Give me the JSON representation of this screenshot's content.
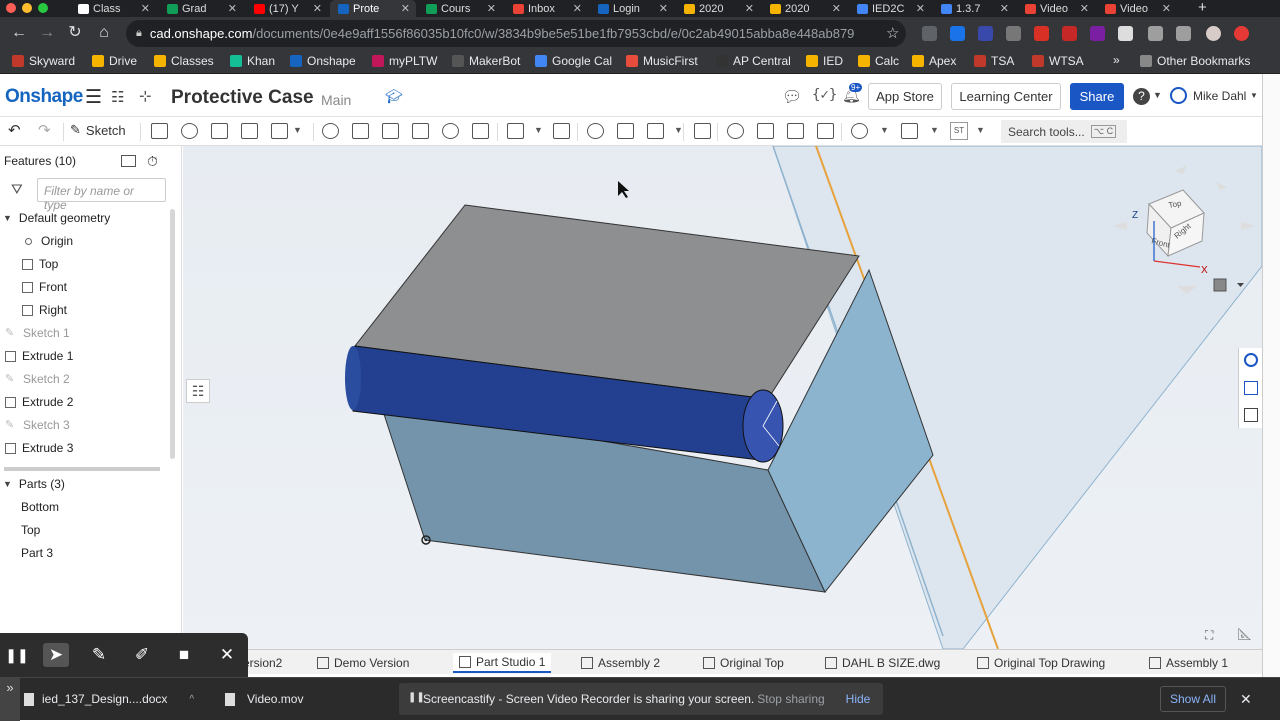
{
  "browser": {
    "tabs": [
      {
        "label": "Class",
        "color": "#ffffff"
      },
      {
        "label": "Grad",
        "color": "#0f9d58"
      },
      {
        "label": "(17) Y",
        "color": "#ff0000"
      },
      {
        "label": "Prote",
        "color": "#1565c0"
      },
      {
        "label": "Cours",
        "color": "#0f9d58"
      },
      {
        "label": "Inbox",
        "color": "#ea4335"
      },
      {
        "label": "Login",
        "color": "#1565c0"
      },
      {
        "label": "2020",
        "color": "#f4b400"
      },
      {
        "label": "2020",
        "color": "#f4b400"
      },
      {
        "label": "IED2C",
        "color": "#4285f4"
      },
      {
        "label": "1.3.7",
        "color": "#4285f4"
      },
      {
        "label": "Video",
        "color": "#ea4335"
      },
      {
        "label": "Video",
        "color": "#ea4335"
      }
    ],
    "url_host": "cad.onshape.com",
    "url_path": "/documents/0e4e9aff1556f86035b10fc0/w/3834b9be5e51be1fb7953cbd/e/0c2ab49015abba8e448ab879",
    "bookmarks": [
      {
        "label": "Skyward",
        "color": "#c0392b"
      },
      {
        "label": "Drive",
        "color": "#f4b400"
      },
      {
        "label": "Classes",
        "color": "#f4b400"
      },
      {
        "label": "Khan",
        "color": "#14bf96"
      },
      {
        "label": "Onshape",
        "color": "#1565c0"
      },
      {
        "label": "myPLTW",
        "color": "#c2185b"
      },
      {
        "label": "MakerBot",
        "color": "#555555"
      },
      {
        "label": "Google Cal",
        "color": "#4285f4"
      },
      {
        "label": "MusicFirst",
        "color": "#e74c3c"
      },
      {
        "label": "AP Central",
        "color": "#333333"
      },
      {
        "label": "IED",
        "color": "#f4b400"
      },
      {
        "label": "Calc",
        "color": "#f4b400"
      },
      {
        "label": "Apex",
        "color": "#f4b400"
      },
      {
        "label": "TSA",
        "color": "#c0392b"
      },
      {
        "label": "WTSA",
        "color": "#c0392b"
      }
    ],
    "bookmarks_more": "»",
    "other_bookmarks": "Other Bookmarks"
  },
  "header": {
    "logo": "Onshape",
    "doc_title": "Protective Case",
    "branch": "Main",
    "notif_count": "9+",
    "app_store": "App Store",
    "learning_center": "Learning Center",
    "share": "Share",
    "user": "Mike Dahl",
    "help": "?"
  },
  "toolbar": {
    "sketch_label": "Sketch",
    "search_label": "Search tools...",
    "search_shortcut": "⌥ C",
    "st_label": "ST"
  },
  "features": {
    "title": "Features (10)",
    "filter_placeholder": "Filter by name or type",
    "default_geometry": "Default geometry",
    "items": [
      {
        "label": "Origin",
        "greyed": false
      },
      {
        "label": "Top",
        "greyed": false
      },
      {
        "label": "Front",
        "greyed": false
      },
      {
        "label": "Right",
        "greyed": false
      },
      {
        "label": "Sketch 1",
        "greyed": true
      },
      {
        "label": "Extrude 1",
        "greyed": false
      },
      {
        "label": "Sketch 2",
        "greyed": true
      },
      {
        "label": "Extrude 2",
        "greyed": false
      },
      {
        "label": "Sketch 3",
        "greyed": true
      },
      {
        "label": "Extrude 3",
        "greyed": false
      }
    ],
    "parts_title": "Parts (3)",
    "parts": [
      "Bottom",
      "Top",
      "Part 3"
    ]
  },
  "viewcube": {
    "top": "Top",
    "front": "Front",
    "right": "Right",
    "axis_z": "Z",
    "axis_x": "X"
  },
  "bottom_tabs": [
    {
      "label": "ersion2",
      "active": false
    },
    {
      "label": "Demo Version",
      "active": false
    },
    {
      "label": "Part Studio 1",
      "active": true
    },
    {
      "label": "Assembly 2",
      "active": false
    },
    {
      "label": "Original Top",
      "active": false
    },
    {
      "label": "DAHL B SIZE.dwg",
      "active": false
    },
    {
      "label": "Original Top Drawing",
      "active": false
    },
    {
      "label": "Assembly 1",
      "active": false
    }
  ],
  "downloads": {
    "file1": "ied_137_Design....docx",
    "file2": "Video.mov",
    "show_all": "Show All"
  },
  "screencastify": {
    "message": "Screencastify - Screen Video Recorder is sharing your screen.",
    "stop": "Stop sharing",
    "hide": "Hide"
  },
  "colors": {
    "accent": "#1a56c4",
    "model_top": "#8e8f91",
    "model_side": "#7494ab",
    "model_right": "#8cb4cf",
    "cylinder": "#22408f"
  }
}
